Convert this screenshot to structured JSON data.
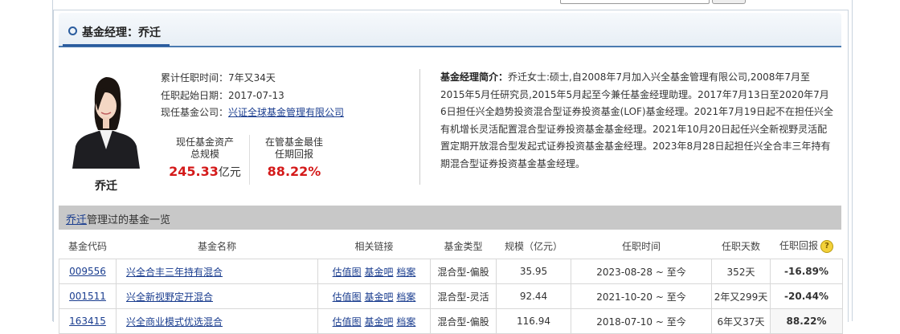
{
  "header": {
    "title": "基金经理：乔迁"
  },
  "manager": {
    "name": "乔迁",
    "tenure_label": "累计任职时间：",
    "tenure_value": "7年又34天",
    "start_label": "任职起始日期：",
    "start_value": "2017-07-13",
    "company_label": "现任基金公司：",
    "company_value": "兴证全球基金管理有限公司",
    "assets_label_line1": "现任基金资产",
    "assets_label_line2": "总规模",
    "assets_value": "245.33",
    "assets_unit": "亿元",
    "best_label_line1": "在管基金最佳",
    "best_label_line2": "任期回报",
    "best_value": "88.22%"
  },
  "bio": {
    "label": "基金经理简介：",
    "text": "乔迁女士:硕士,自2008年7月加入兴全基金管理有限公司,2008年7月至2015年5月任研究员,2015年5月起至今兼任基金经理助理。2017年7月13日至2020年7月6日担任兴全趋势投资混合型证券投资基金(LOF)基金经理。2021年7月19日起不在担任兴全有机增长灵活配置混合型证券投资基金基金经理。2021年10月20日起任兴全新视野灵活配置定期开放混合型发起式证券投资基金基金经理。2023年8月28日起担任兴全合丰三年持有期混合型证券投资基金基金经理。"
  },
  "fund_list": {
    "title_link": "乔迁",
    "title_rest": "管理过的基金一览",
    "columns": [
      "基金代码",
      "基金名称",
      "相关链接",
      "基金类型",
      "规模（亿元）",
      "任职时间",
      "任职天数",
      "任职回报"
    ],
    "link_labels": [
      "估值图",
      "基金吧",
      "档案"
    ],
    "rows": [
      {
        "code": "009556",
        "name": "兴全合丰三年持有混合",
        "type": "混合型-偏股",
        "scale": "35.95",
        "period": "2023-08-28 ~ 至今",
        "days": "352天",
        "return": "-16.89%"
      },
      {
        "code": "001511",
        "name": "兴全新视野定开混合",
        "type": "混合型-灵活",
        "scale": "92.44",
        "period": "2021-10-20 ~ 至今",
        "days": "2年又299天",
        "return": "-20.44%"
      },
      {
        "code": "163415",
        "name": "兴全商业模式优选混合",
        "type": "混合型-偏股",
        "scale": "116.94",
        "period": "2018-07-10 ~ 至今",
        "days": "6年又37天",
        "return": "88.22%"
      }
    ]
  },
  "colors": {
    "accent": "#2a5c9e",
    "negative": "#1a8a1a",
    "positive": "#d41a1a",
    "link": "#1a3d8f"
  }
}
